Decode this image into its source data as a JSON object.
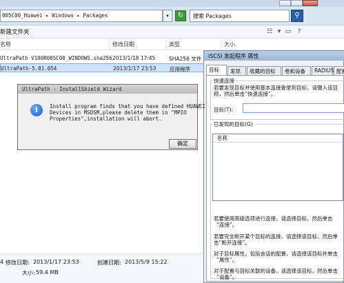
{
  "explorer": {
    "address": "005C00_Huawei ▸ Windows ▸ Packages",
    "search_placeholder": "搜索 Packages",
    "new_folder_label": "新建文件夹",
    "columns": [
      "名称",
      "修改日期",
      "类型",
      "大小"
    ],
    "files": [
      {
        "name": "UltraPath V100R005C00_WINDOWS.sha256",
        "date": "2013/1/18 17:45",
        "type": "SHA256 文件",
        "size": ""
      },
      {
        "name": "UltraPath-5.01.054",
        "date": "2013/1/17 23:53",
        "type": "应用程序",
        "size": ""
      }
    ],
    "status": {
      "count": "4",
      "modified_label": "修改日期:",
      "modified_value": "2013/1/17 23:53",
      "created_label": "创建日期:",
      "created_value": "2013/5/9 15:22",
      "size_label": "大小:",
      "size_value": "59.4 MB"
    }
  },
  "iscsi": {
    "title": "iSCSI 发起程序 属性",
    "tabs": [
      "目标",
      "发现",
      "收藏的目标",
      "卷和设备",
      "RADIUS",
      "配置"
    ],
    "quick_connect": {
      "title": "快速连接",
      "line1": "若要发现目标并使用基本连接登录到目标，请键入该目",
      "line2": "称，然后单击“快速连接”。",
      "target_label": "目标(T):"
    },
    "discovered": {
      "title": "已发现的目标(G)",
      "column_name": "名称"
    },
    "help": [
      [
        "若要使用高级选项进行连接，请选择目标，然后单击",
        "“连接”。"
      ],
      [
        "若要完全断开某个目标的连接，请选择该目标，然后单",
        "击“断开连接”。"
      ],
      [
        "对于目标属性，包括会话的配置，请选择该目标并单击",
        "“属性”。"
      ],
      [
        "对于配置与目标关联的设备，请选择该目标，然后单击",
        "“设备”。"
      ]
    ]
  },
  "installshield": {
    "title": "UltraPath - InstallShield Wizard",
    "message": "Install program finds that you have defined HUAWEI\nDevices in MSDSM,please delete them in \"MPIO\nProperties\",installation will abort.",
    "ok_label": "确定"
  }
}
